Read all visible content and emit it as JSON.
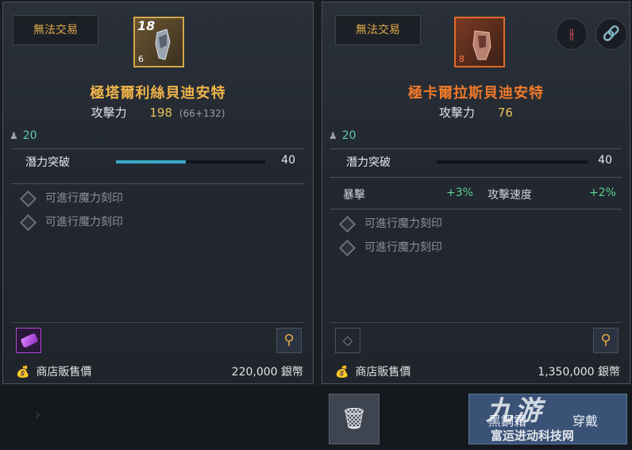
{
  "left": {
    "trade_status": "無法交易",
    "item_level": "18",
    "item_tier": "6",
    "item_name": "極塔爾利絲貝迪安特",
    "attack_label": "攻擊力",
    "attack_value": "198",
    "attack_detail": "(66+132)",
    "req_level": "20",
    "breakthrough_label": "潛力突破",
    "breakthrough_value": "40",
    "breakthrough_progress_pct": 47,
    "engravings": [
      "可進行魔力刻印",
      "可進行魔力刻印"
    ],
    "price_label": "商店販售價",
    "price_value": "220,000 銀幣"
  },
  "right": {
    "trade_status": "無法交易",
    "item_tier": "8",
    "item_name": "極卡爾拉斯貝迪安特",
    "attack_label": "攻擊力",
    "attack_value": "76",
    "req_level": "20",
    "breakthrough_label": "潛力突破",
    "breakthrough_value": "40",
    "stats": [
      {
        "label": "暴擊",
        "value": "+3%"
      },
      {
        "label": "攻擊速度",
        "value": "+2%"
      }
    ],
    "engravings": [
      "可進行魔力刻印",
      "可進行魔力刻印"
    ],
    "price_label": "商店販售價",
    "price_value": "1,350,000 銀幣"
  },
  "bottom": {
    "action_label_a": "黑鋼霜",
    "action_label_b": "穿戴"
  },
  "watermark": {
    "logo": "九游",
    "text": "富运进动科技网"
  },
  "colors": {
    "legendary_name": "#f0b54a",
    "relic_name": "#f07a2a",
    "stat_positive": "#5ad08a",
    "level": "#5ec9b8"
  },
  "icons": [
    "pawn-icon",
    "diamond-slot-icon",
    "gem-icon",
    "pin-icon",
    "money-bag-icon",
    "dismantle-icon",
    "link-icon",
    "trash-icon",
    "chevron-right-icon"
  ]
}
